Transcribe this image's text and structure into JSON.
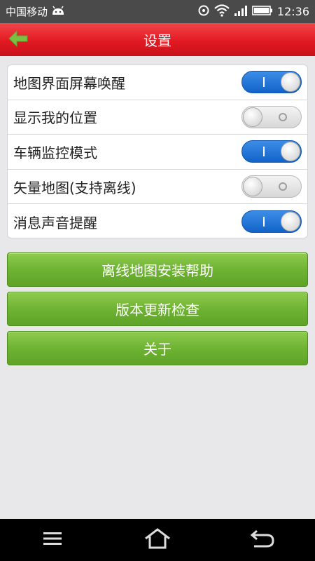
{
  "status_bar": {
    "carrier": "中国移动",
    "time": "12:36",
    "icons": [
      "android-icon",
      "sync-icon",
      "wifi-icon",
      "signal-icon",
      "battery-icon"
    ]
  },
  "header": {
    "title": "设置",
    "back_icon": "arrow-left-icon",
    "accent_color": "#e11a22"
  },
  "settings": [
    {
      "label": "地图界面屏幕唤醒",
      "state": "on"
    },
    {
      "label": "显示我的位置",
      "state": "off"
    },
    {
      "label": "车辆监控模式",
      "state": "on"
    },
    {
      "label": "矢量地图(支持离线)",
      "state": "off"
    },
    {
      "label": "消息声音提醒",
      "state": "on"
    }
  ],
  "buttons": {
    "offline_map_help": "离线地图安装帮助",
    "check_update": "版本更新检查",
    "about": "关于"
  },
  "nav": {
    "icons": [
      "menu-icon",
      "home-icon",
      "back-icon"
    ]
  },
  "colors": {
    "toggle_on": "#1a6fd6",
    "button_green": "#6fb333",
    "back_arrow": "#7ac143"
  }
}
